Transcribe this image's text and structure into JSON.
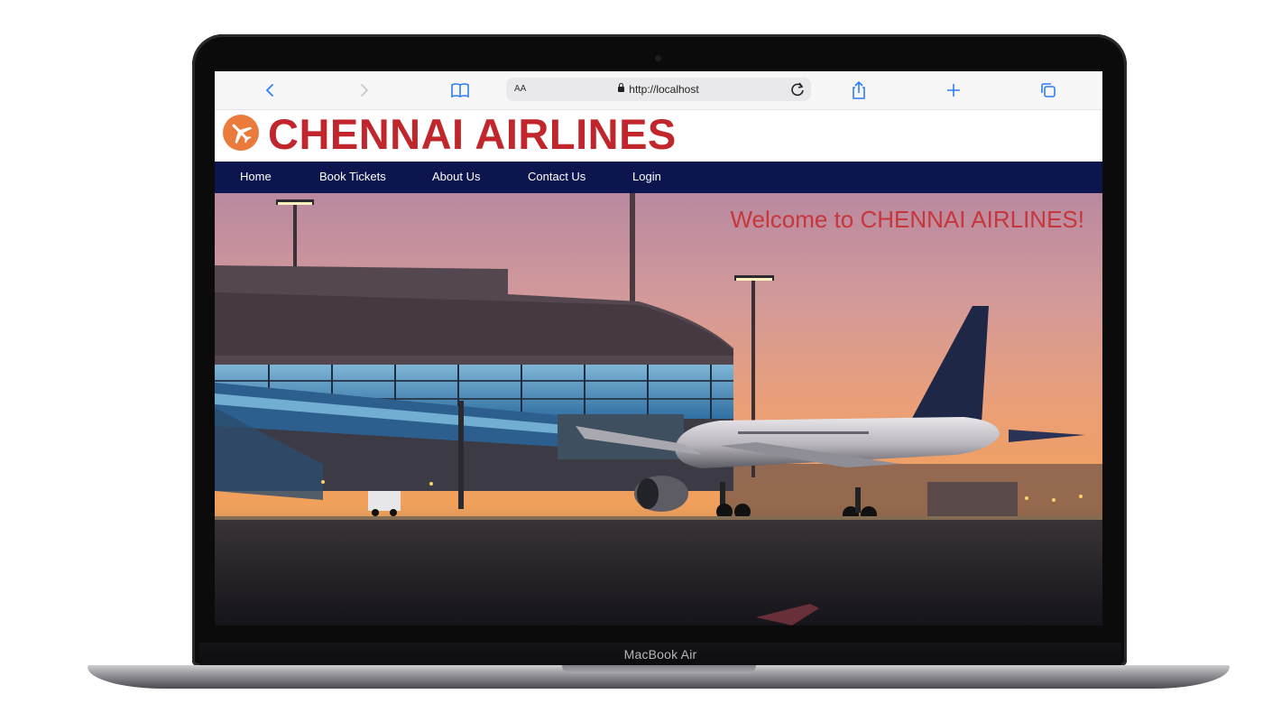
{
  "device": {
    "model_label": "MacBook Air"
  },
  "browser": {
    "text_size_button": "AA",
    "url": "http://localhost",
    "icons": [
      "chevron-left-icon",
      "chevron-right-icon",
      "book-icon",
      "lock-icon",
      "reload-icon",
      "share-icon",
      "plus-icon",
      "tabs-icon"
    ]
  },
  "site": {
    "title": "CHENNAI AIRLINES",
    "logo_icon": "airplane-icon",
    "brand_color": "#c0262b",
    "logo_color": "#ea7b3c",
    "nav_color": "#0c154e",
    "nav": [
      {
        "label": "Home"
      },
      {
        "label": "Book Tickets"
      },
      {
        "label": "About Us"
      },
      {
        "label": "Contact Us"
      },
      {
        "label": "Login"
      }
    ],
    "hero": {
      "welcome": "Welcome to CHENNAI AIRLINES!",
      "image": "airport-terminal-with-airplane-at-dusk"
    }
  }
}
